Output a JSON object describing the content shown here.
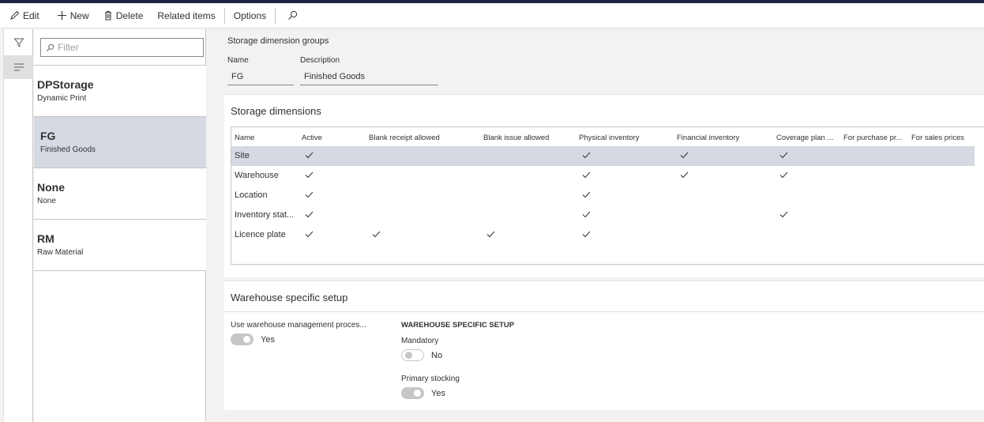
{
  "toolbar": {
    "edit": "Edit",
    "new": "New",
    "delete": "Delete",
    "related_items": "Related items",
    "options": "Options"
  },
  "filter": {
    "placeholder": "Filter"
  },
  "list_items": [
    {
      "title": "DPStorage",
      "subtitle": "Dynamic Print"
    },
    {
      "title": "FG",
      "subtitle": "Finished Goods"
    },
    {
      "title": "None",
      "subtitle": "None"
    },
    {
      "title": "RM",
      "subtitle": "Raw Material"
    }
  ],
  "header": {
    "title": "Storage dimension groups",
    "name_label": "Name",
    "name_value": "FG",
    "description_label": "Description",
    "description_value": "Finished Goods"
  },
  "storage_dimensions": {
    "title": "Storage dimensions",
    "columns": [
      "Name",
      "Active",
      "Blank receipt allowed",
      "Blank issue allowed",
      "Physical inventory",
      "Financial inventory",
      "Coverage plan ...",
      "For purchase pr...",
      "For sales prices"
    ],
    "rows": [
      {
        "name": "Site",
        "checks": [
          true,
          false,
          false,
          true,
          true,
          true,
          false,
          false
        ]
      },
      {
        "name": "Warehouse",
        "checks": [
          true,
          false,
          false,
          true,
          true,
          true,
          false,
          false
        ]
      },
      {
        "name": "Location",
        "checks": [
          true,
          false,
          false,
          true,
          false,
          false,
          false,
          false
        ]
      },
      {
        "name": "Inventory stat...",
        "checks": [
          true,
          false,
          false,
          true,
          false,
          true,
          false,
          false
        ]
      },
      {
        "name": "Licence plate",
        "checks": [
          true,
          true,
          true,
          true,
          false,
          false,
          false,
          false
        ]
      }
    ]
  },
  "warehouse_setup": {
    "title": "Warehouse specific setup",
    "use_wms_label": "Use warehouse management proces...",
    "use_wms_value": "Yes",
    "subheading": "WAREHOUSE SPECIFIC SETUP",
    "mandatory_label": "Mandatory",
    "mandatory_value": "No",
    "primary_stocking_label": "Primary stocking",
    "primary_stocking_value": "Yes"
  }
}
